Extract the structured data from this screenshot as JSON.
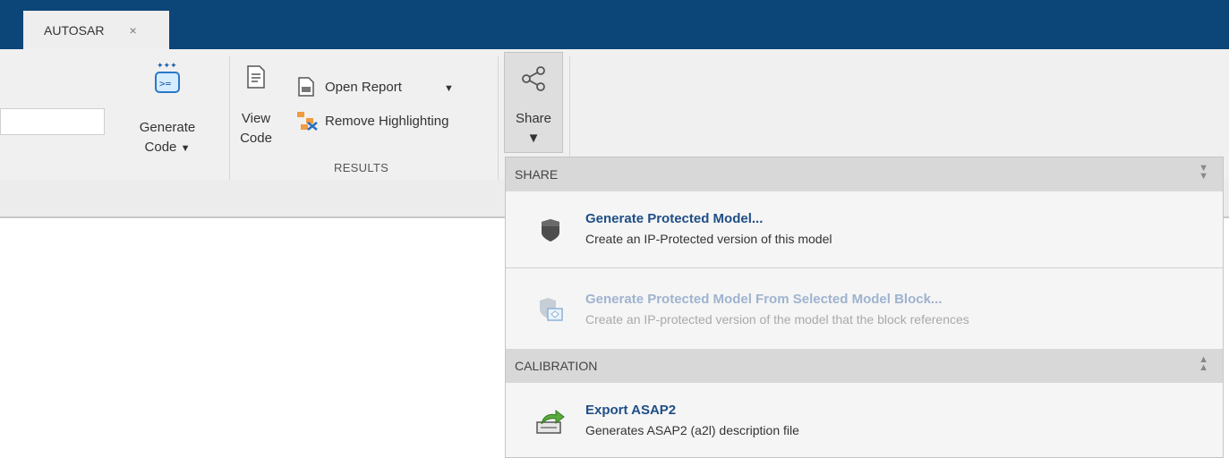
{
  "tabs": {
    "active_label": "AUTOSAR",
    "close_glyph": "×"
  },
  "ribbon": {
    "generate_code": {
      "line1": "Generate",
      "line2": "Code",
      "caret": "▼",
      "icon": "generate-code-icon"
    },
    "view_code": {
      "line1": "View",
      "line2": "Code",
      "icon": "view-code-icon"
    },
    "open_report": {
      "label": "Open Report",
      "caret": "▼",
      "icon": "report-icon"
    },
    "remove_highlighting": {
      "label": "Remove Highlighting",
      "icon": "remove-highlighting-icon"
    },
    "results_group_label": "RESULTS",
    "share": {
      "label": "Share",
      "caret": "▼",
      "icon": "share-icon"
    }
  },
  "share_menu": {
    "share_section": {
      "header": "SHARE",
      "arrow": "collapse"
    },
    "items": [
      {
        "title": "Generate Protected Model...",
        "desc": "Create an IP-Protected version of this model",
        "icon": "shield-icon",
        "enabled": true
      },
      {
        "title": "Generate Protected Model From Selected Model Block...",
        "desc": "Create an IP-protected version of the model that the block references",
        "icon": "shield-block-icon",
        "enabled": false
      }
    ],
    "calibration_section": {
      "header": "CALIBRATION",
      "arrow": "expand"
    },
    "calibration_items": [
      {
        "title": "Export ASAP2",
        "desc": "Generates ASAP2 (a2l) description file",
        "icon": "export-icon",
        "enabled": true
      }
    ]
  },
  "colors": {
    "titlebar": "#0c4577",
    "ribbon_bg": "#f0f0f0",
    "link_blue": "#1f4e86",
    "disabled_blue": "#9fb3cf",
    "section_header": "#d8d8d8"
  }
}
